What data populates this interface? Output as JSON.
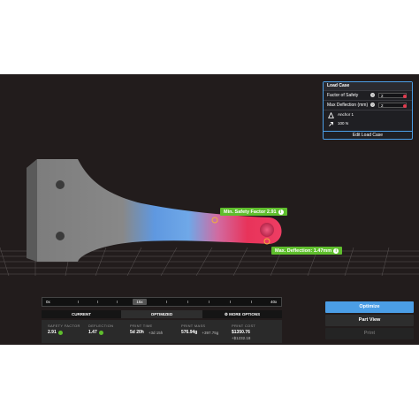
{
  "callouts": {
    "safety": "Min. Safety Factor 2.91",
    "deflection": "Max. Deflection: 1.47mm"
  },
  "load_case": {
    "title": "Load Case",
    "rows": [
      {
        "label": "Factor of Safety",
        "value": "2"
      },
      {
        "label": "Max Deflection (mm)",
        "value": "2"
      }
    ],
    "items": [
      {
        "label": "Anchor 1",
        "icon": "anchor-triangle-icon"
      },
      {
        "label": "100 N",
        "icon": "force-arrow-icon"
      }
    ],
    "edit_label": "Edit Load Case"
  },
  "timeline": {
    "start": "0x",
    "current": "15x",
    "end": "40x"
  },
  "tabs": {
    "current": "CURRENT",
    "optimized": "OPTIMIZED",
    "more": "MORE OPTIONS"
  },
  "stats": {
    "safety_factor": {
      "label": "SAFETY FACTOR",
      "value": "2.91"
    },
    "deflection": {
      "label": "DEFLECTION",
      "value": "1.47"
    },
    "print_time": {
      "label": "PRINT TIME",
      "value": "5d 20h",
      "delta": "+3d 15h"
    },
    "print_mass": {
      "label": "PRINT MASS",
      "value": "576.94g",
      "delta": "+397.75g"
    },
    "print_cost": {
      "label": "PRINT COST",
      "value": "$1350.76",
      "delta": "+$1232.18"
    }
  },
  "buttons": {
    "optimize": "Optimize",
    "part_view": "Part View",
    "print": "Print"
  },
  "colors": {
    "accent": "#4b9ee6",
    "success": "#5fbe2d",
    "stress_high": "#e8335a",
    "stress_low": "#6fa8e8"
  }
}
